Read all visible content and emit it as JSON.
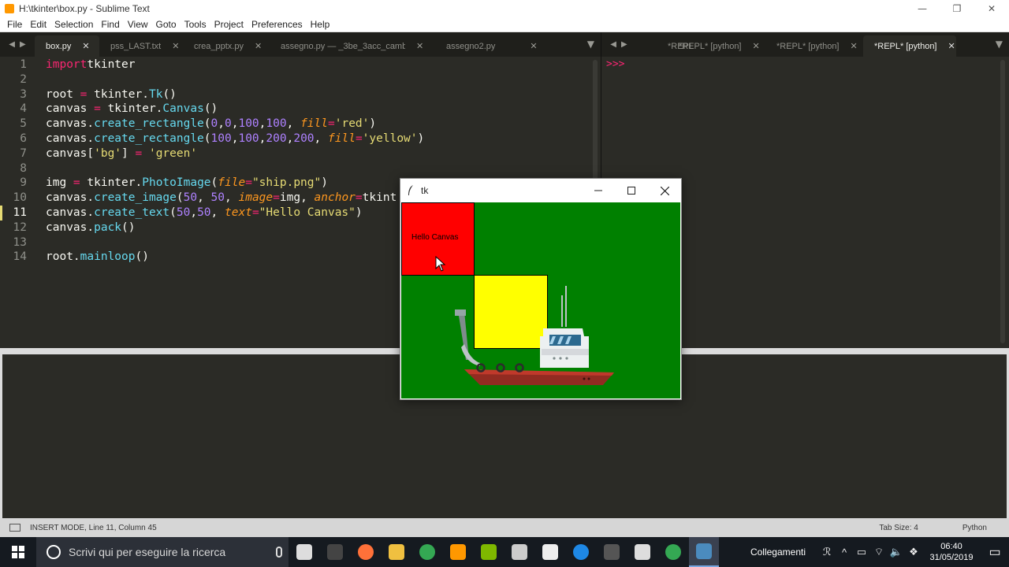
{
  "window": {
    "title": "H:\\tkinter\\box.py - Sublime Text",
    "minimize_glyph": "—",
    "maximize_glyph": "❐",
    "close_glyph": "✕"
  },
  "menu": [
    "File",
    "Edit",
    "Selection",
    "Find",
    "View",
    "Goto",
    "Tools",
    "Project",
    "Preferences",
    "Help"
  ],
  "tabs_left": [
    {
      "label": "box.py",
      "active": true
    },
    {
      "label": "pss_LAST.txt",
      "active": false
    },
    {
      "label": "crea_pptx.py",
      "active": false
    },
    {
      "label": "assegno.py — _3be_3acc_cambiali",
      "active": false
    },
    {
      "label": "assegno2.py",
      "active": false
    }
  ],
  "tabs_right": [
    {
      "label": "*REPL",
      "active": false
    },
    {
      "label": "*REPL* [python]",
      "active": false
    },
    {
      "label": "*REPL* [python]",
      "active": false
    },
    {
      "label": "*REPL* [python]",
      "active": true
    }
  ],
  "tab_close_glyph": "✕",
  "editor": {
    "current_line": 11,
    "lines": [
      {
        "n": "1",
        "tokens": [
          [
            "kw",
            "import"
          ],
          [
            "",
            "tkinter"
          ]
        ]
      },
      {
        "n": "2",
        "tokens": []
      },
      {
        "n": "3",
        "tokens": [
          [
            "",
            "root "
          ],
          [
            "op",
            "="
          ],
          [
            "",
            " tkinter."
          ],
          [
            "fn",
            "Tk"
          ],
          [
            "",
            "()"
          ]
        ]
      },
      {
        "n": "4",
        "tokens": [
          [
            "",
            "canvas "
          ],
          [
            "op",
            "="
          ],
          [
            "",
            " tkinter."
          ],
          [
            "fn",
            "Canvas"
          ],
          [
            "",
            "()"
          ]
        ]
      },
      {
        "n": "5",
        "tokens": [
          [
            "",
            "canvas."
          ],
          [
            "fn",
            "create_rectangle"
          ],
          [
            "",
            "("
          ],
          [
            "num-lit",
            "0"
          ],
          [
            "",
            ","
          ],
          [
            "num-lit",
            "0"
          ],
          [
            "",
            ","
          ],
          [
            "num-lit",
            "100"
          ],
          [
            "",
            ","
          ],
          [
            "num-lit",
            "100"
          ],
          [
            "",
            ", "
          ],
          [
            "arg",
            "fill"
          ],
          [
            "op",
            "="
          ],
          [
            "str",
            "'red'"
          ],
          [
            "",
            ")"
          ]
        ]
      },
      {
        "n": "6",
        "tokens": [
          [
            "",
            "canvas."
          ],
          [
            "fn",
            "create_rectangle"
          ],
          [
            "",
            "("
          ],
          [
            "num-lit",
            "100"
          ],
          [
            "",
            ","
          ],
          [
            "num-lit",
            "100"
          ],
          [
            "",
            ","
          ],
          [
            "num-lit",
            "200"
          ],
          [
            "",
            ","
          ],
          [
            "num-lit",
            "200"
          ],
          [
            "",
            ", "
          ],
          [
            "arg",
            "fill"
          ],
          [
            "op",
            "="
          ],
          [
            "str",
            "'yellow'"
          ],
          [
            "",
            ")"
          ]
        ]
      },
      {
        "n": "7",
        "tokens": [
          [
            "",
            "canvas["
          ],
          [
            "str",
            "'bg'"
          ],
          [
            "",
            "] "
          ],
          [
            "op",
            "="
          ],
          [
            "",
            ""
          ],
          [
            "str",
            " 'green'"
          ]
        ]
      },
      {
        "n": "8",
        "tokens": []
      },
      {
        "n": "9",
        "tokens": [
          [
            "",
            "img "
          ],
          [
            "op",
            "="
          ],
          [
            "",
            " tkinter."
          ],
          [
            "fn",
            "PhotoImage"
          ],
          [
            "",
            "("
          ],
          [
            "arg",
            "file"
          ],
          [
            "op",
            "="
          ],
          [
            "str",
            "\"ship.png\""
          ],
          [
            "",
            ")"
          ]
        ]
      },
      {
        "n": "10",
        "tokens": [
          [
            "",
            "canvas."
          ],
          [
            "fn",
            "create_image"
          ],
          [
            "",
            "("
          ],
          [
            "num-lit",
            "50"
          ],
          [
            "",
            ", "
          ],
          [
            "num-lit",
            "50"
          ],
          [
            "",
            ", "
          ],
          [
            "arg",
            "image"
          ],
          [
            "op",
            "="
          ],
          [
            "",
            "img, "
          ],
          [
            "arg",
            "anchor"
          ],
          [
            "op",
            "="
          ],
          [
            "",
            "tkint"
          ]
        ]
      },
      {
        "n": "11",
        "tokens": [
          [
            "",
            "canvas."
          ],
          [
            "fn",
            "create_text"
          ],
          [
            "",
            "("
          ],
          [
            "num-lit",
            "50"
          ],
          [
            "",
            ","
          ],
          [
            "num-lit",
            "50"
          ],
          [
            "",
            ", "
          ],
          [
            "arg",
            "text"
          ],
          [
            "op",
            "="
          ],
          [
            "str",
            "\"Hello Canvas\""
          ],
          [
            "",
            ")"
          ]
        ]
      },
      {
        "n": "12",
        "tokens": [
          [
            "",
            "canvas."
          ],
          [
            "fn",
            "pack"
          ],
          [
            "",
            "()"
          ]
        ]
      },
      {
        "n": "13",
        "tokens": []
      },
      {
        "n": "14",
        "tokens": [
          [
            "",
            "root."
          ],
          [
            "fn",
            "mainloop"
          ],
          [
            "",
            "()"
          ]
        ]
      }
    ]
  },
  "repl": {
    "prompt": ">>>"
  },
  "statusbar": {
    "left": "INSERT MODE, Line 11, Column 45",
    "tab_size": "Tab Size: 4",
    "syntax": "Python"
  },
  "taskbar": {
    "search_placeholder": "Scrivi qui per eseguire la ricerca",
    "apps": [
      {
        "name": "task-view",
        "color": "#dddddd"
      },
      {
        "name": "cmd",
        "color": "#444444"
      },
      {
        "name": "firefox",
        "color": "#ff7139"
      },
      {
        "name": "explorer-python",
        "color": "#f0c040"
      },
      {
        "name": "chrome",
        "color": "#34a853"
      },
      {
        "name": "sublime",
        "color": "#ff9800"
      },
      {
        "name": "app-green",
        "color": "#7fb800"
      },
      {
        "name": "app-inkscape",
        "color": "#cccccc"
      },
      {
        "name": "app-fox",
        "color": "#eeeeee"
      },
      {
        "name": "app-blue-orb",
        "color": "#1e88e5"
      },
      {
        "name": "app-generic",
        "color": "#555555"
      },
      {
        "name": "app-snake",
        "color": "#dddddd"
      },
      {
        "name": "chrome-2",
        "color": "#34a853"
      },
      {
        "name": "python-idle",
        "color": "#4b8bbe"
      }
    ],
    "active_app": 13,
    "tray_label": "Collegamenti",
    "tray_icons": [
      "ℛ",
      "^",
      "▭",
      "⌔",
      "🔈",
      "❖"
    ],
    "time": "06:40",
    "date": "31/05/2019",
    "notification_glyph": "▭"
  },
  "tk_window": {
    "title": "tk",
    "canvas_text": "Hello Canvas",
    "canvas_bg": "#008000",
    "rect_colors": [
      "#ff0000",
      "#ffff00"
    ]
  }
}
